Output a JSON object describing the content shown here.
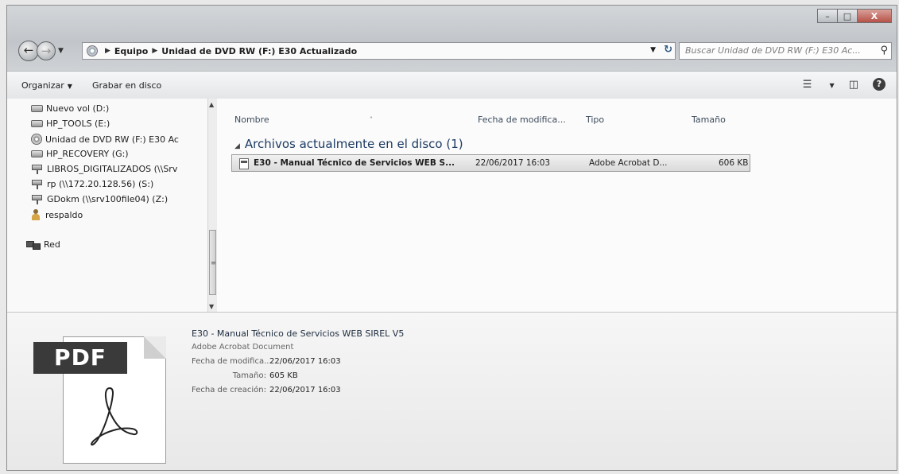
{
  "window": {
    "caption_buttons": {
      "minimize": "–",
      "maximize": "□",
      "close": "X"
    }
  },
  "navigation": {
    "back_icon": "back-arrow-icon",
    "forward_icon": "forward-arrow-icon",
    "breadcrumb": [
      "Equipo",
      "Unidad de DVD RW (F:) E30 Actualizado"
    ],
    "refresh_icon": "refresh-icon",
    "search_placeholder": "Buscar Unidad de DVD RW (F:) E30 Ac...",
    "search_icon": "search-icon"
  },
  "commandbar": {
    "organize_label": "Organizar",
    "burn_label": "Grabar en disco"
  },
  "sidebar": {
    "items": [
      {
        "label": "Nuevo vol (D:)",
        "icon": "drive-icon"
      },
      {
        "label": "HP_TOOLS (E:)",
        "icon": "drive-icon"
      },
      {
        "label": "Unidad de DVD RW (F:) E30 Ac",
        "icon": "dvd-icon"
      },
      {
        "label": "HP_RECOVERY (G:)",
        "icon": "drive-icon"
      },
      {
        "label": "LIBROS_DIGITALIZADOS (\\\\Srv",
        "icon": "network-drive-icon"
      },
      {
        "label": "rp (\\\\172.20.128.56) (S:)",
        "icon": "network-drive-icon"
      },
      {
        "label": "GDokm (\\\\srv100file04) (Z:)",
        "icon": "network-drive-icon"
      },
      {
        "label": "respaldo",
        "icon": "user-folder-icon"
      }
    ],
    "network_label": "Red"
  },
  "file_list": {
    "columns": [
      "Nombre",
      "Fecha de modifica...",
      "Tipo",
      "Tamaño"
    ],
    "group_header": "Archivos actualmente en el disco (1)",
    "rows": [
      {
        "name": "E30 - Manual Técnico de Servicios WEB S...",
        "date": "22/06/2017 16:03",
        "type": "Adobe Acrobat D...",
        "size": "606 KB"
      }
    ]
  },
  "details_pane": {
    "thumbnail_label": "PDF",
    "title": "E30 - Manual Técnico de Servicios WEB SIREL V5",
    "kind": "Adobe Acrobat Document",
    "modified_key": "Fecha de modifica...",
    "modified_value": "22/06/2017 16:03",
    "size_key": "Tamaño:",
    "size_value": "605 KB",
    "created_key": "Fecha de creación:",
    "created_value": "22/06/2017 16:03"
  }
}
